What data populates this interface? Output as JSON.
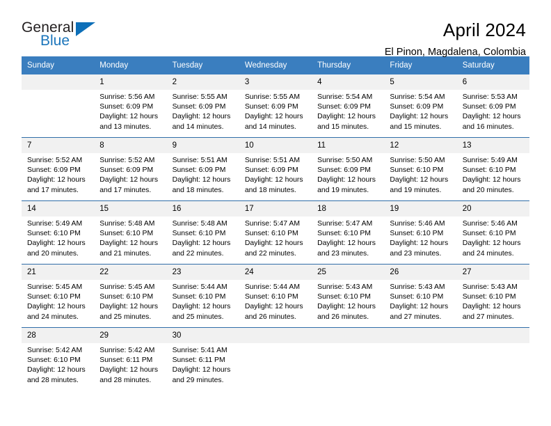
{
  "logo": {
    "text_primary": "General",
    "text_secondary": "Blue",
    "primary_color": "#231f20",
    "secondary_color": "#1b75bb",
    "triangle_color": "#0d6fb8"
  },
  "header": {
    "title": "April 2024",
    "subtitle": "El Pinon, Magdalena, Colombia"
  },
  "theme": {
    "header_row_bg": "#3a7ebf",
    "header_row_text": "#ffffff",
    "day_number_bg": "#f1f1f1",
    "row_separator": "#2f6da8"
  },
  "calendar": {
    "weekdays": [
      "Sunday",
      "Monday",
      "Tuesday",
      "Wednesday",
      "Thursday",
      "Friday",
      "Saturday"
    ],
    "weeks": [
      [
        {
          "day": "",
          "lines": []
        },
        {
          "day": "1",
          "lines": [
            "Sunrise: 5:56 AM",
            "Sunset: 6:09 PM",
            "Daylight: 12 hours",
            "and 13 minutes."
          ]
        },
        {
          "day": "2",
          "lines": [
            "Sunrise: 5:55 AM",
            "Sunset: 6:09 PM",
            "Daylight: 12 hours",
            "and 14 minutes."
          ]
        },
        {
          "day": "3",
          "lines": [
            "Sunrise: 5:55 AM",
            "Sunset: 6:09 PM",
            "Daylight: 12 hours",
            "and 14 minutes."
          ]
        },
        {
          "day": "4",
          "lines": [
            "Sunrise: 5:54 AM",
            "Sunset: 6:09 PM",
            "Daylight: 12 hours",
            "and 15 minutes."
          ]
        },
        {
          "day": "5",
          "lines": [
            "Sunrise: 5:54 AM",
            "Sunset: 6:09 PM",
            "Daylight: 12 hours",
            "and 15 minutes."
          ]
        },
        {
          "day": "6",
          "lines": [
            "Sunrise: 5:53 AM",
            "Sunset: 6:09 PM",
            "Daylight: 12 hours",
            "and 16 minutes."
          ]
        }
      ],
      [
        {
          "day": "7",
          "lines": [
            "Sunrise: 5:52 AM",
            "Sunset: 6:09 PM",
            "Daylight: 12 hours",
            "and 17 minutes."
          ]
        },
        {
          "day": "8",
          "lines": [
            "Sunrise: 5:52 AM",
            "Sunset: 6:09 PM",
            "Daylight: 12 hours",
            "and 17 minutes."
          ]
        },
        {
          "day": "9",
          "lines": [
            "Sunrise: 5:51 AM",
            "Sunset: 6:09 PM",
            "Daylight: 12 hours",
            "and 18 minutes."
          ]
        },
        {
          "day": "10",
          "lines": [
            "Sunrise: 5:51 AM",
            "Sunset: 6:09 PM",
            "Daylight: 12 hours",
            "and 18 minutes."
          ]
        },
        {
          "day": "11",
          "lines": [
            "Sunrise: 5:50 AM",
            "Sunset: 6:09 PM",
            "Daylight: 12 hours",
            "and 19 minutes."
          ]
        },
        {
          "day": "12",
          "lines": [
            "Sunrise: 5:50 AM",
            "Sunset: 6:10 PM",
            "Daylight: 12 hours",
            "and 19 minutes."
          ]
        },
        {
          "day": "13",
          "lines": [
            "Sunrise: 5:49 AM",
            "Sunset: 6:10 PM",
            "Daylight: 12 hours",
            "and 20 minutes."
          ]
        }
      ],
      [
        {
          "day": "14",
          "lines": [
            "Sunrise: 5:49 AM",
            "Sunset: 6:10 PM",
            "Daylight: 12 hours",
            "and 20 minutes."
          ]
        },
        {
          "day": "15",
          "lines": [
            "Sunrise: 5:48 AM",
            "Sunset: 6:10 PM",
            "Daylight: 12 hours",
            "and 21 minutes."
          ]
        },
        {
          "day": "16",
          "lines": [
            "Sunrise: 5:48 AM",
            "Sunset: 6:10 PM",
            "Daylight: 12 hours",
            "and 22 minutes."
          ]
        },
        {
          "day": "17",
          "lines": [
            "Sunrise: 5:47 AM",
            "Sunset: 6:10 PM",
            "Daylight: 12 hours",
            "and 22 minutes."
          ]
        },
        {
          "day": "18",
          "lines": [
            "Sunrise: 5:47 AM",
            "Sunset: 6:10 PM",
            "Daylight: 12 hours",
            "and 23 minutes."
          ]
        },
        {
          "day": "19",
          "lines": [
            "Sunrise: 5:46 AM",
            "Sunset: 6:10 PM",
            "Daylight: 12 hours",
            "and 23 minutes."
          ]
        },
        {
          "day": "20",
          "lines": [
            "Sunrise: 5:46 AM",
            "Sunset: 6:10 PM",
            "Daylight: 12 hours",
            "and 24 minutes."
          ]
        }
      ],
      [
        {
          "day": "21",
          "lines": [
            "Sunrise: 5:45 AM",
            "Sunset: 6:10 PM",
            "Daylight: 12 hours",
            "and 24 minutes."
          ]
        },
        {
          "day": "22",
          "lines": [
            "Sunrise: 5:45 AM",
            "Sunset: 6:10 PM",
            "Daylight: 12 hours",
            "and 25 minutes."
          ]
        },
        {
          "day": "23",
          "lines": [
            "Sunrise: 5:44 AM",
            "Sunset: 6:10 PM",
            "Daylight: 12 hours",
            "and 25 minutes."
          ]
        },
        {
          "day": "24",
          "lines": [
            "Sunrise: 5:44 AM",
            "Sunset: 6:10 PM",
            "Daylight: 12 hours",
            "and 26 minutes."
          ]
        },
        {
          "day": "25",
          "lines": [
            "Sunrise: 5:43 AM",
            "Sunset: 6:10 PM",
            "Daylight: 12 hours",
            "and 26 minutes."
          ]
        },
        {
          "day": "26",
          "lines": [
            "Sunrise: 5:43 AM",
            "Sunset: 6:10 PM",
            "Daylight: 12 hours",
            "and 27 minutes."
          ]
        },
        {
          "day": "27",
          "lines": [
            "Sunrise: 5:43 AM",
            "Sunset: 6:10 PM",
            "Daylight: 12 hours",
            "and 27 minutes."
          ]
        }
      ],
      [
        {
          "day": "28",
          "lines": [
            "Sunrise: 5:42 AM",
            "Sunset: 6:10 PM",
            "Daylight: 12 hours",
            "and 28 minutes."
          ]
        },
        {
          "day": "29",
          "lines": [
            "Sunrise: 5:42 AM",
            "Sunset: 6:11 PM",
            "Daylight: 12 hours",
            "and 28 minutes."
          ]
        },
        {
          "day": "30",
          "lines": [
            "Sunrise: 5:41 AM",
            "Sunset: 6:11 PM",
            "Daylight: 12 hours",
            "and 29 minutes."
          ]
        },
        {
          "day": "",
          "lines": []
        },
        {
          "day": "",
          "lines": []
        },
        {
          "day": "",
          "lines": []
        },
        {
          "day": "",
          "lines": []
        }
      ]
    ]
  }
}
